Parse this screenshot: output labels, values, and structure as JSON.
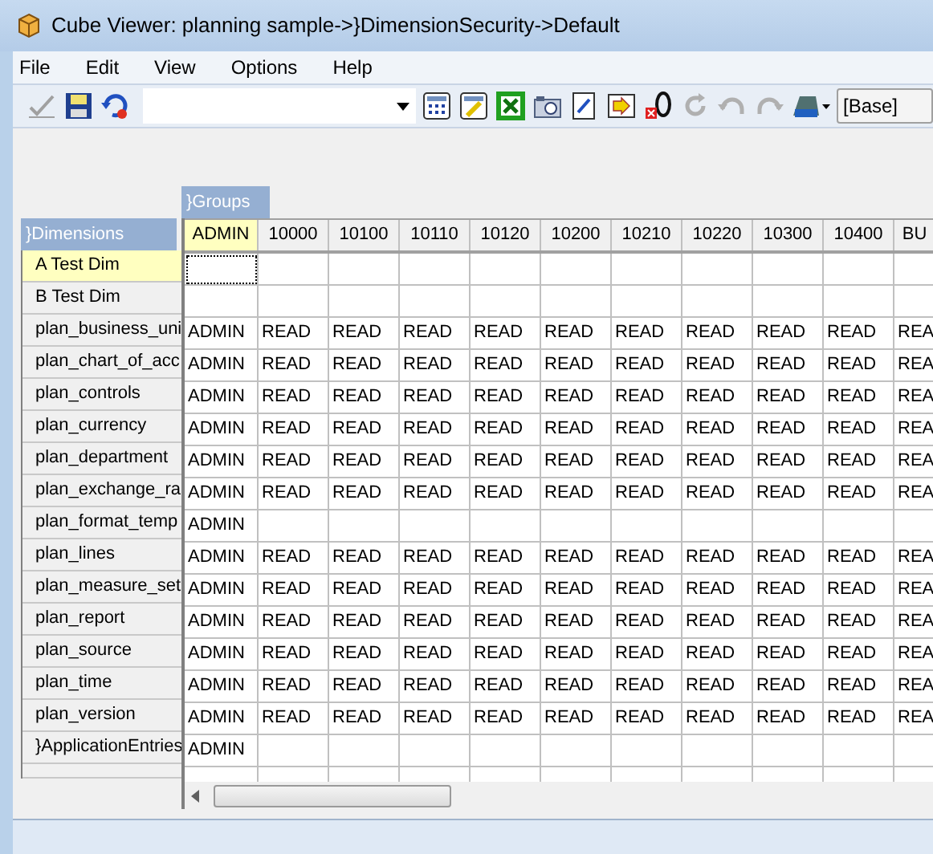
{
  "window": {
    "title": "Cube Viewer: planning sample->}DimensionSecurity->Default"
  },
  "menu": [
    "File",
    "Edit",
    "View",
    "Options",
    "Help"
  ],
  "toolbar": {
    "subset_value": "[Base]"
  },
  "grid": {
    "column_dimension": "}Groups",
    "row_dimension": "}Dimensions",
    "columns": [
      {
        "label": "ADMIN",
        "selected": true
      },
      {
        "label": "10000",
        "selected": false
      },
      {
        "label": "10100",
        "selected": false
      },
      {
        "label": "10110",
        "selected": false
      },
      {
        "label": "10120",
        "selected": false
      },
      {
        "label": "10200",
        "selected": false
      },
      {
        "label": "10210",
        "selected": false
      },
      {
        "label": "10220",
        "selected": false
      },
      {
        "label": "10300",
        "selected": false
      },
      {
        "label": "10400",
        "selected": false
      },
      {
        "label": "BU",
        "selected": false
      }
    ],
    "rows": [
      {
        "label": "A Test Dim",
        "selected": true,
        "cells": []
      },
      {
        "label": "B Test Dim",
        "selected": false,
        "cells": []
      },
      {
        "label": "plan_business_uni",
        "selected": false,
        "cells": [
          "ADMIN",
          "READ",
          "READ",
          "READ",
          "READ",
          "READ",
          "READ",
          "READ",
          "READ",
          "READ",
          "REA"
        ]
      },
      {
        "label": "plan_chart_of_acc",
        "selected": false,
        "cells": [
          "ADMIN",
          "READ",
          "READ",
          "READ",
          "READ",
          "READ",
          "READ",
          "READ",
          "READ",
          "READ",
          "REA"
        ]
      },
      {
        "label": "plan_controls",
        "selected": false,
        "cells": [
          "ADMIN",
          "READ",
          "READ",
          "READ",
          "READ",
          "READ",
          "READ",
          "READ",
          "READ",
          "READ",
          "REA"
        ]
      },
      {
        "label": "plan_currency",
        "selected": false,
        "cells": [
          "ADMIN",
          "READ",
          "READ",
          "READ",
          "READ",
          "READ",
          "READ",
          "READ",
          "READ",
          "READ",
          "REA"
        ]
      },
      {
        "label": "plan_department",
        "selected": false,
        "cells": [
          "ADMIN",
          "READ",
          "READ",
          "READ",
          "READ",
          "READ",
          "READ",
          "READ",
          "READ",
          "READ",
          "REA"
        ]
      },
      {
        "label": "plan_exchange_ra",
        "selected": false,
        "cells": [
          "ADMIN",
          "READ",
          "READ",
          "READ",
          "READ",
          "READ",
          "READ",
          "READ",
          "READ",
          "READ",
          "REA"
        ]
      },
      {
        "label": "plan_format_temp",
        "selected": false,
        "cells": [
          "ADMIN"
        ]
      },
      {
        "label": "plan_lines",
        "selected": false,
        "cells": [
          "ADMIN",
          "READ",
          "READ",
          "READ",
          "READ",
          "READ",
          "READ",
          "READ",
          "READ",
          "READ",
          "REA"
        ]
      },
      {
        "label": "plan_measure_set",
        "selected": false,
        "cells": [
          "ADMIN",
          "READ",
          "READ",
          "READ",
          "READ",
          "READ",
          "READ",
          "READ",
          "READ",
          "READ",
          "REA"
        ]
      },
      {
        "label": "plan_report",
        "selected": false,
        "cells": [
          "ADMIN",
          "READ",
          "READ",
          "READ",
          "READ",
          "READ",
          "READ",
          "READ",
          "READ",
          "READ",
          "REA"
        ]
      },
      {
        "label": "plan_source",
        "selected": false,
        "cells": [
          "ADMIN",
          "READ",
          "READ",
          "READ",
          "READ",
          "READ",
          "READ",
          "READ",
          "READ",
          "READ",
          "REA"
        ]
      },
      {
        "label": "plan_time",
        "selected": false,
        "cells": [
          "ADMIN",
          "READ",
          "READ",
          "READ",
          "READ",
          "READ",
          "READ",
          "READ",
          "READ",
          "READ",
          "REA"
        ]
      },
      {
        "label": "plan_version",
        "selected": false,
        "cells": [
          "ADMIN",
          "READ",
          "READ",
          "READ",
          "READ",
          "READ",
          "READ",
          "READ",
          "READ",
          "READ",
          "REA"
        ]
      },
      {
        "label": "}ApplicationEntries",
        "selected": false,
        "cells": [
          "ADMIN"
        ]
      }
    ]
  }
}
